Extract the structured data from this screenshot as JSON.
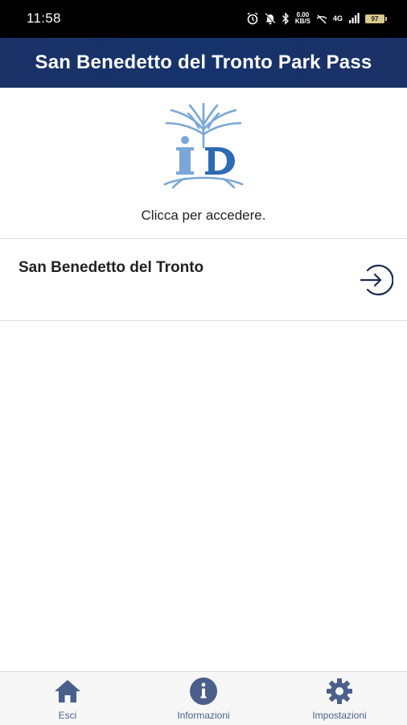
{
  "status_bar": {
    "time": "11:58",
    "network_speed_value": "0.00",
    "network_speed_unit": "KB/S",
    "signal": "4G",
    "battery": "97"
  },
  "app_bar": {
    "title": "San Benedetto del Tronto Park Pass"
  },
  "login": {
    "hint": "Clicca per accedere.",
    "entry": {
      "title": "San Benedetto del Tronto",
      "action_icon": "login-arrow-icon"
    }
  },
  "bottom_nav": {
    "items": [
      {
        "label": "Esci",
        "icon": "home-icon"
      },
      {
        "label": "Informazioni",
        "icon": "info-icon"
      },
      {
        "label": "Impostazioni",
        "icon": "gear-icon"
      }
    ]
  },
  "colors": {
    "app_bar": "#1a3266",
    "accent": "#17336c",
    "nav_icon": "#4a5f8a",
    "logo_light": "#7aa7d8",
    "logo_dark": "#2d6bb5"
  }
}
